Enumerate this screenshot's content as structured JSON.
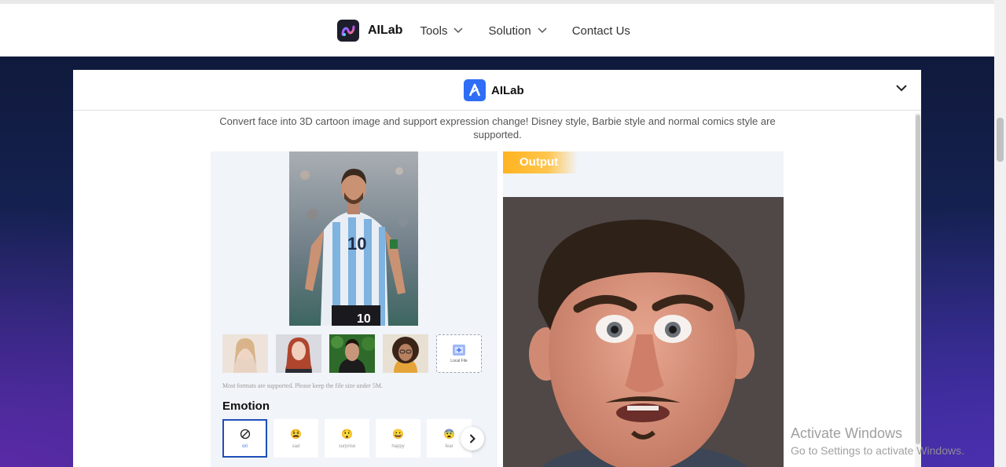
{
  "nav": {
    "brand": "AILab",
    "items": [
      {
        "label": "Tools",
        "has_dropdown": true
      },
      {
        "label": "Solution",
        "has_dropdown": true
      },
      {
        "label": "Contact Us",
        "has_dropdown": false
      }
    ]
  },
  "panel": {
    "brand": "AILab",
    "description": "Convert face into 3D cartoon image and support expression change! Disney style, Barbie style and normal comics style are supported.",
    "input": {
      "local_file_label": "Local File",
      "hint": "Most formats are supported. Please keep the file size under 5M.",
      "emotion_title": "Emotion",
      "emotions": [
        {
          "label": "ori",
          "icon": "none-icon",
          "selected": true
        },
        {
          "label": "sad",
          "icon": "sad-emoji-icon",
          "selected": false
        },
        {
          "label": "surprise",
          "icon": "surprise-emoji-icon",
          "selected": false
        },
        {
          "label": "happy",
          "icon": "happy-emoji-icon",
          "selected": false
        },
        {
          "label": "fear",
          "icon": "fear-emoji-icon",
          "selected": false
        }
      ]
    },
    "output": {
      "badge": "Output"
    }
  },
  "watermark": {
    "title": "Activate Windows",
    "subtitle": "Go to Settings to activate Windows."
  },
  "colors": {
    "accent_blue": "#2e6df6",
    "output_badge": "#ffb320",
    "backdrop": "#17245a"
  }
}
